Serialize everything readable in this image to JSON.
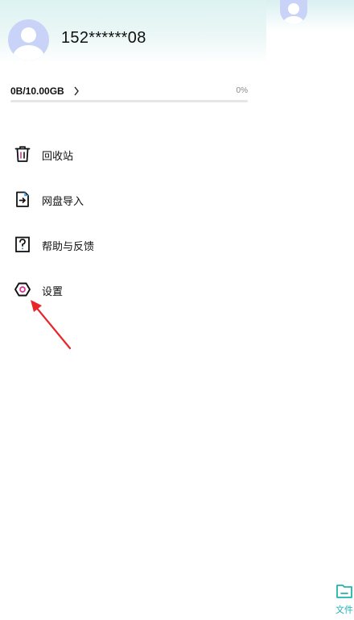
{
  "profile": {
    "username": "152******08"
  },
  "storage": {
    "usage_text": "0B/10.00GB",
    "percent_text": "0%",
    "used_fraction": 0.0
  },
  "menu": {
    "items": [
      {
        "label": "回收站",
        "icon": "trash-icon"
      },
      {
        "label": "网盘导入",
        "icon": "import-icon"
      },
      {
        "label": "帮助与反馈",
        "icon": "help-icon"
      },
      {
        "label": "设置",
        "icon": "settings-icon"
      }
    ]
  },
  "bottom_tab": {
    "files_label": "文件"
  },
  "colors": {
    "accent": "#22b3b0",
    "annotation_arrow": "#e8262a",
    "avatar": "#c9d3f7"
  }
}
